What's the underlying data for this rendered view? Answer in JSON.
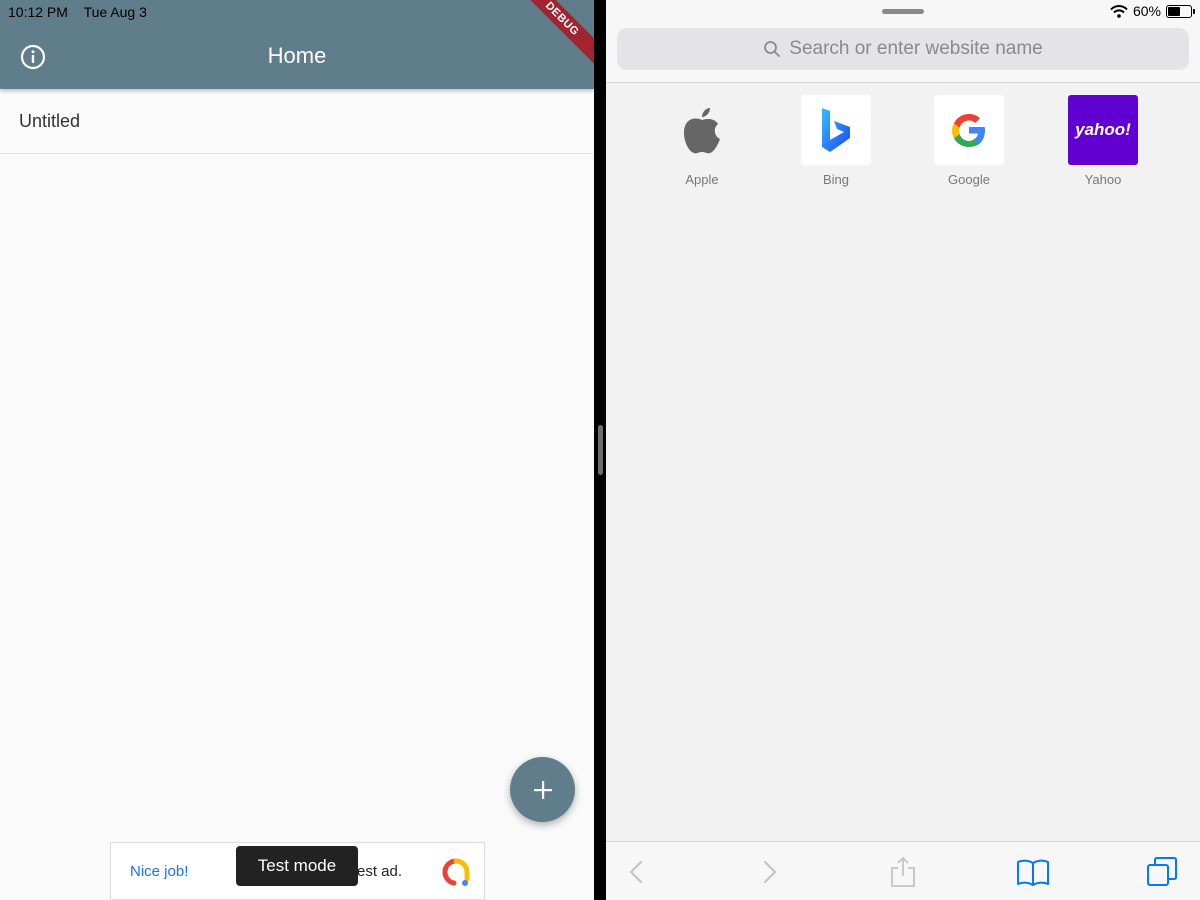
{
  "left_app": {
    "status": {
      "time": "10:12 PM",
      "date": "Tue Aug 3"
    },
    "app_bar": {
      "title": "Home",
      "debug_label": "DEBUG",
      "info_icon": "info-circle-icon"
    },
    "list": [
      {
        "title": "Untitled"
      }
    ],
    "fab": {
      "icon": "plus-icon"
    },
    "ad": {
      "nice_text": "Nice job!",
      "ad_text": "est ad.",
      "toast": "Test mode"
    },
    "colors": {
      "app_bar": "#607d8b",
      "debug_ribbon": "#a3242f",
      "link": "#1a73e8"
    }
  },
  "right_app": {
    "status": {
      "battery": "60%",
      "wifi_icon": "wifi-icon",
      "battery_level": 0.6
    },
    "search": {
      "placeholder": "Search or enter website name"
    },
    "favorites": [
      {
        "label": "Apple",
        "icon": "apple-logo-icon"
      },
      {
        "label": "Bing",
        "icon": "bing-logo-icon"
      },
      {
        "label": "Google",
        "icon": "google-logo-icon"
      },
      {
        "label": "Yahoo",
        "icon": "yahoo-logo-icon",
        "logo_text": "yahoo!"
      }
    ],
    "toolbar": [
      {
        "name": "back",
        "icon": "chevron-left-icon"
      },
      {
        "name": "forward",
        "icon": "chevron-right-icon"
      },
      {
        "name": "share",
        "icon": "share-icon"
      },
      {
        "name": "bookmarks",
        "icon": "book-icon"
      },
      {
        "name": "tabs",
        "icon": "tabs-icon"
      }
    ],
    "colors": {
      "accent": "#007aff",
      "yahoo": "#6001d2"
    }
  }
}
